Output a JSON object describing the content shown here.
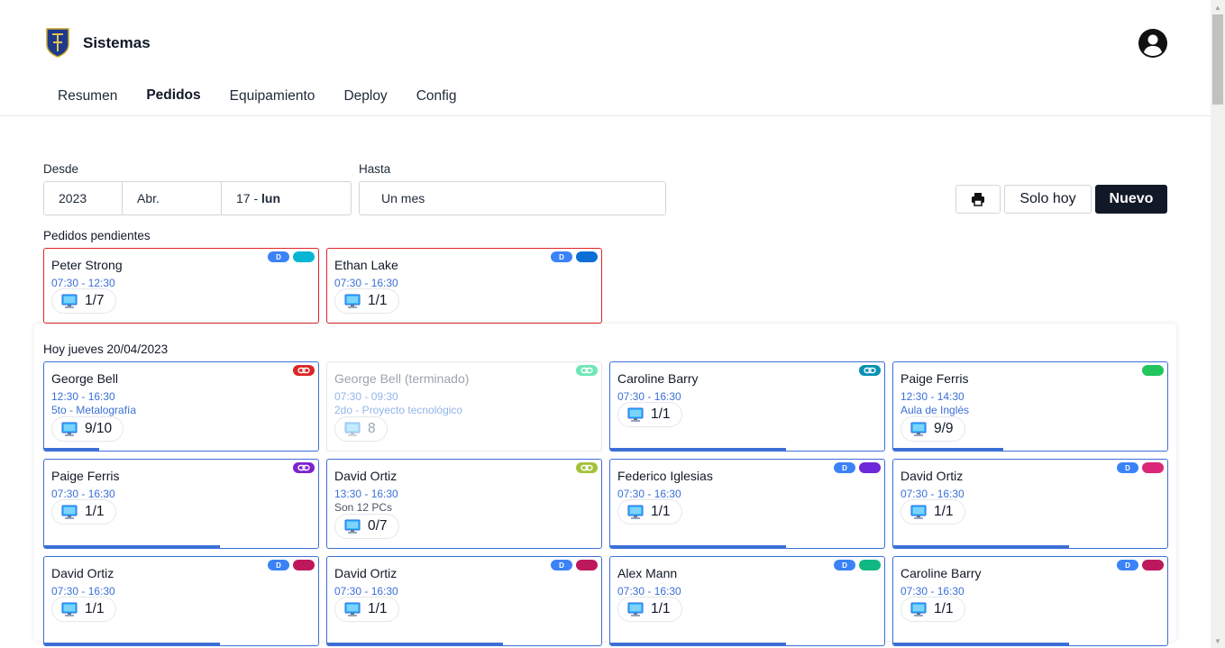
{
  "app": {
    "title": "Sistemas"
  },
  "colors": {
    "accent": "#3b6fd6",
    "pending_border": "#dc2626",
    "primary_button": "#111827"
  },
  "nav": {
    "tabs": [
      "Resumen",
      "Pedidos",
      "Equipamiento",
      "Deploy",
      "Config"
    ],
    "active": "Pedidos"
  },
  "filters": {
    "desde_label": "Desde",
    "year": "2023",
    "month": "Abr.",
    "day": "17",
    "day_sep": " - ",
    "weekday": "lun",
    "hasta_label": "Hasta",
    "hasta_value": "Un mes"
  },
  "actions": {
    "print_icon": "printer-icon",
    "solo_hoy": "Solo hoy",
    "nuevo": "Nuevo"
  },
  "pending": {
    "title": "Pedidos pendientes",
    "cards": [
      {
        "name": "Peter Strong",
        "time": "07:30 - 12:30",
        "count": "1/7",
        "badge_d": "D",
        "tag_color": "#06b6d4"
      },
      {
        "name": "Ethan Lake",
        "time": "07:30 - 16:30",
        "count": "1/1",
        "badge_d": "D",
        "tag_color": "#0b6fd6"
      }
    ]
  },
  "today": {
    "title": "Hoy jueves 20/04/2023",
    "cards": [
      {
        "name": "George Bell",
        "time": "12:30 - 16:30",
        "sub": "5to - Metalografía",
        "count": "9/10",
        "tag_color": "#dc2626",
        "tag_icon": "link-icon",
        "progress": 0.2
      },
      {
        "name": "George Bell (terminado)",
        "time": "07:30 - 09:30",
        "sub": "2do - Proyecto tecnológico",
        "count": "8",
        "tag_color": "#6ee7b7",
        "tag_icon": "link-icon",
        "done": true
      },
      {
        "name": "Caroline Barry",
        "time": "07:30 - 16:30",
        "count": "1/1",
        "tag_color": "#0891b2",
        "tag_icon": "link-icon",
        "progress": 0.64
      },
      {
        "name": "Paige Ferris",
        "time": "12:30 - 14:30",
        "sub": "Aula de Inglés",
        "count": "9/9",
        "tag_color": "#22c55e",
        "progress": 0.4
      },
      {
        "name": "Paige Ferris",
        "time": "07:30 - 16:30",
        "count": "1/1",
        "tag_color": "#7e22ce",
        "tag_icon": "link-icon",
        "progress": 0.64
      },
      {
        "name": "David Ortiz",
        "time": "13:30 - 16:30",
        "sub": "Son 12 PCs",
        "sub_note": true,
        "count": "0/7",
        "tag_color": "#a3c23a",
        "tag_icon": "link-icon"
      },
      {
        "name": "Federico Iglesias",
        "time": "07:30 - 16:30",
        "count": "1/1",
        "badge_d": "D",
        "tag_color": "#6d28d9",
        "progress": 0.64
      },
      {
        "name": "David Ortiz",
        "time": "07:30 - 16:30",
        "count": "1/1",
        "badge_d": "D",
        "tag_color": "#db2777",
        "progress": 0.64
      },
      {
        "name": "David Ortiz",
        "time": "07:30 - 16:30",
        "count": "1/1",
        "badge_d": "D",
        "tag_color": "#be185d",
        "progress": 0.64
      },
      {
        "name": "David Ortiz",
        "time": "07:30 - 16:30",
        "count": "1/1",
        "badge_d": "D",
        "tag_color": "#be185d",
        "progress": 0.64
      },
      {
        "name": "Alex Mann",
        "time": "07:30 - 16:30",
        "count": "1/1",
        "badge_d": "D",
        "tag_color": "#10b981",
        "progress": 0.64
      },
      {
        "name": "Caroline Barry",
        "time": "07:30 - 16:30",
        "count": "1/1",
        "badge_d": "D",
        "tag_color": "#be185d",
        "progress": 0.64
      }
    ]
  }
}
